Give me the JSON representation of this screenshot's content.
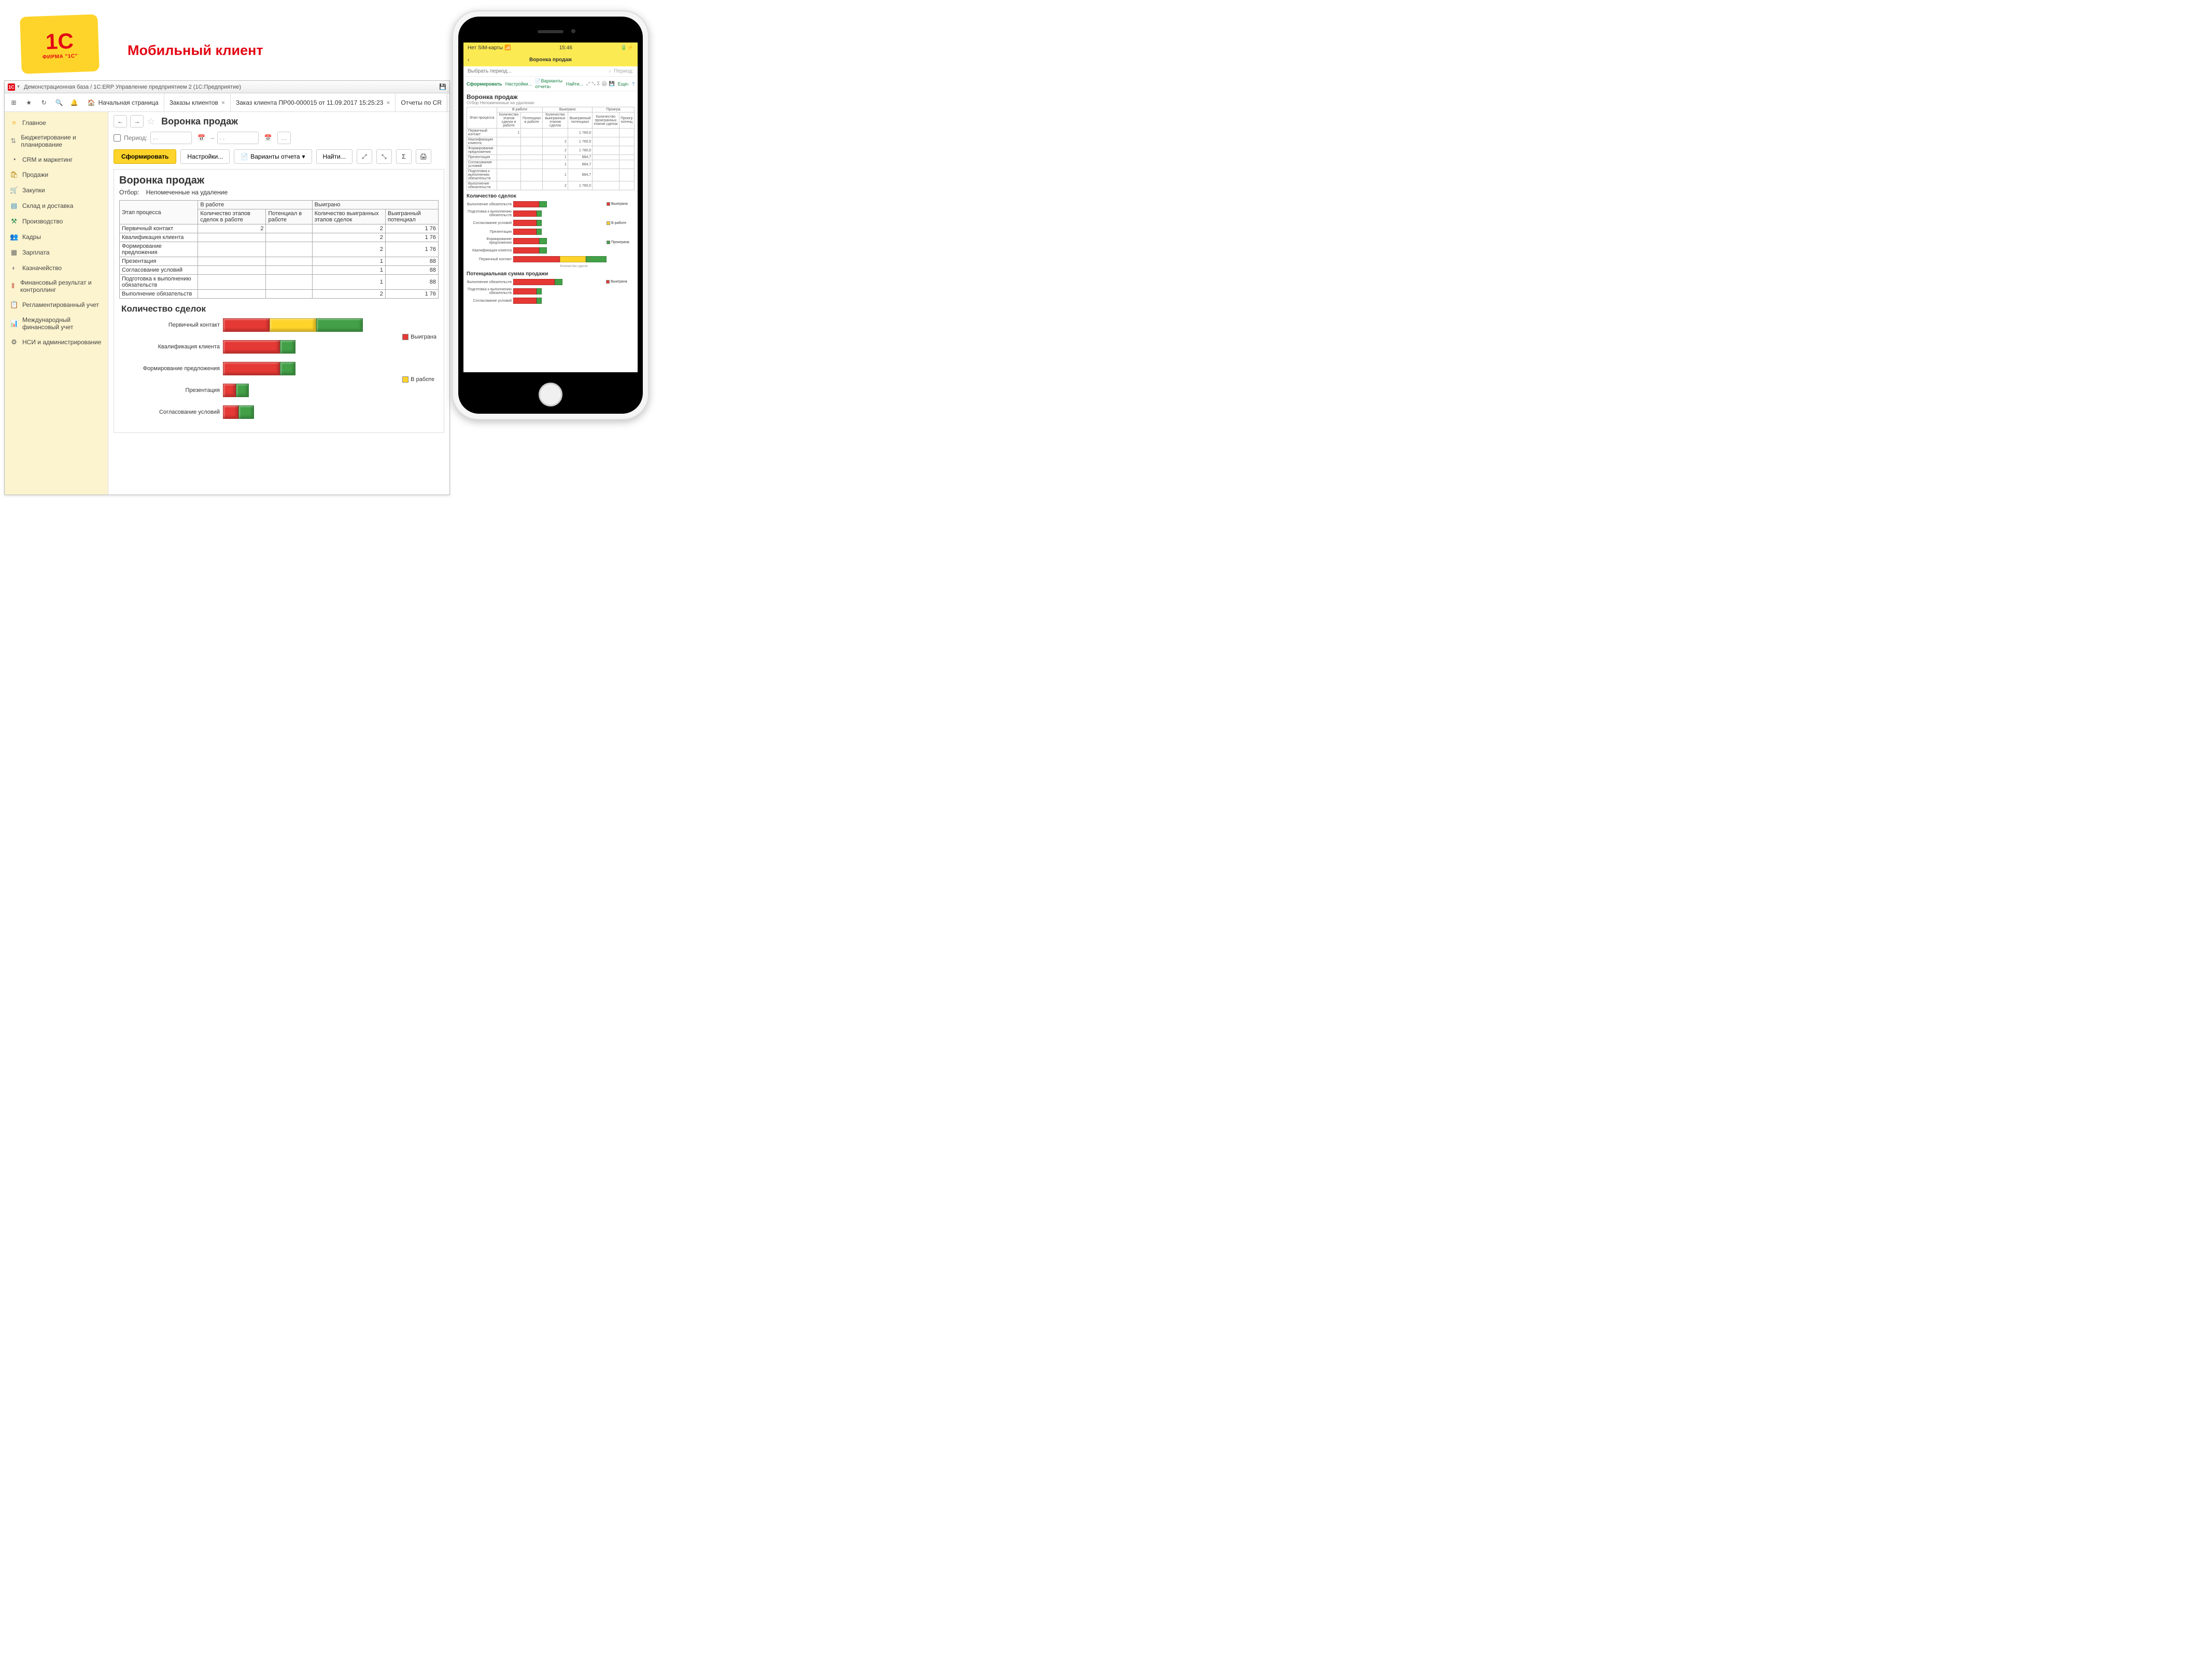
{
  "slide_title": "Мобильный клиент",
  "logo_text": "1C",
  "logo_sub": "ФИРМА \"1С\"",
  "window_title": "Демонстрационная база / 1С:ERP Управление предприятием 2  (1С:Предприятие)",
  "tabs": [
    {
      "label": "Начальная страница",
      "home": true
    },
    {
      "label": "Заказы клиентов",
      "closable": true
    },
    {
      "label": "Заказ клиента ПР00-000015 от 11.09.2017 15:25:23",
      "closable": true
    },
    {
      "label": "Отчеты по CR"
    }
  ],
  "sidebar": [
    {
      "icon": "≡",
      "cls": "sic-hamb",
      "label": "Главное"
    },
    {
      "icon": "⇅",
      "cls": "sic-bud",
      "label": "Бюджетирование и планирование"
    },
    {
      "icon": "◔",
      "cls": "sic-crm",
      "label": "CRM и маркетинг"
    },
    {
      "icon": "🛍",
      "cls": "sic-prod",
      "label": "Продажи"
    },
    {
      "icon": "🛒",
      "cls": "sic-cart",
      "label": "Закупки"
    },
    {
      "icon": "▤",
      "cls": "sic-store",
      "label": "Склад и доставка"
    },
    {
      "icon": "⚒",
      "cls": "sic-mfg",
      "label": "Производство"
    },
    {
      "icon": "👥",
      "cls": "sic-hr",
      "label": "Кадры"
    },
    {
      "icon": "▦",
      "cls": "sic-pay",
      "label": "Зарплата"
    },
    {
      "icon": "◐",
      "cls": "sic-treas",
      "label": "Казначейство"
    },
    {
      "icon": "⫴",
      "cls": "sic-fin",
      "label": "Финансовый результат и контроллинг"
    },
    {
      "icon": "📋",
      "cls": "sic-reg",
      "label": "Регламентированный учет"
    },
    {
      "icon": "📊",
      "cls": "sic-ifrs",
      "label": "Международный финансовый учет"
    },
    {
      "icon": "⚙",
      "cls": "sic-admin",
      "label": "НСИ и администрирование"
    }
  ],
  "page_title": "Воронка продаж",
  "period": {
    "label": "Период:",
    "from_placeholder": ". .",
    "to_placeholder": ". ."
  },
  "actions": {
    "form": "Сформировать",
    "settings": "Настройки...",
    "variants": "Варианты отчета",
    "find": "Найти..."
  },
  "report": {
    "title": "Воронка продаж",
    "filter_label": "Отбор:",
    "filter_value": "Непомеченные на удаление",
    "headers_top": [
      "Этап процесса",
      "В работе",
      "Выиграно"
    ],
    "headers_sub": [
      "Количество этапов сделок в работе",
      "Потенциал в работе",
      "Количество выигранных этапов сделок",
      "Выигранный потенциал"
    ],
    "rows": [
      {
        "stage": "Первичный контакт",
        "in_work": 2,
        "won": 2,
        "won_pot": "1 76"
      },
      {
        "stage": "Квалификация клиента",
        "in_work": "",
        "won": 2,
        "won_pot": "1 76"
      },
      {
        "stage": "Формирование предложения",
        "in_work": "",
        "won": 2,
        "won_pot": "1 76"
      },
      {
        "stage": "Презентация",
        "in_work": "",
        "won": 1,
        "won_pot": "88"
      },
      {
        "stage": "Согласование условий",
        "in_work": "",
        "won": 1,
        "won_pot": "88"
      },
      {
        "stage": "Подготовка к выполнению обязательств",
        "in_work": "",
        "won": 1,
        "won_pot": "88"
      },
      {
        "stage": "Выполнение обязательств",
        "in_work": "",
        "won": 2,
        "won_pot": "1 76"
      }
    ]
  },
  "chart_title": "Количество сделок",
  "chart_data": {
    "type": "bar",
    "orientation": "horizontal",
    "title": "Количество сделок",
    "stacked": true,
    "categories": [
      "Первичный контакт",
      "Квалификация клиента",
      "Формирование предложения",
      "Презентация",
      "Согласование условий"
    ],
    "series": [
      {
        "name": "Выиграна",
        "color": "#e53935",
        "values": [
          90,
          110,
          110,
          25,
          30
        ]
      },
      {
        "name": "В работе",
        "color": "#ffd42a",
        "values": [
          90,
          0,
          0,
          0,
          0
        ]
      },
      {
        "name": "Проиграна",
        "color": "#43a047",
        "values": [
          90,
          30,
          30,
          25,
          30
        ]
      }
    ],
    "legend": [
      "Выиграна",
      "В работе"
    ]
  },
  "mobile": {
    "status_left": "Нет SIM-карты",
    "status_time": "15:46",
    "title": "Воронка продаж",
    "period_placeholder": "Выбрать период...",
    "period_label": "Период:",
    "act_form": "Сформировать",
    "act_settings": "Настройки...",
    "act_variants": "Варианты отчета",
    "act_find": "Найти...",
    "act_more": "Еще",
    "report_title": "Воронка продаж",
    "filter": "Отбор   Непомеченные на удаление",
    "headers": [
      "Этап процесса",
      "В работе",
      "",
      "Выиграно",
      "",
      "Проигра"
    ],
    "sub_headers": [
      "",
      "Количество этапов сделок в работе",
      "Потенциал в работе",
      "Количество выигранных этапов сделок",
      "Выигранный потенциал",
      "Количество проигранных этапов сделок",
      "Проигр потенц"
    ],
    "rows": [
      {
        "stage": "Первичный контакт",
        "c1": "1",
        "c3": "",
        "c4": "1 760,0"
      },
      {
        "stage": "Квалификация клиента",
        "c1": "",
        "c3": "2",
        "c4": "1 760,0"
      },
      {
        "stage": "Формирование предложения",
        "c1": "",
        "c3": "2",
        "c4": "1 760,0"
      },
      {
        "stage": "Презентация",
        "c1": "",
        "c3": "1",
        "c4": "884,7"
      },
      {
        "stage": "Согласование условий",
        "c1": "",
        "c3": "1",
        "c4": "884,7"
      },
      {
        "stage": "Подготовка к выполнению обязательств",
        "c1": "",
        "c3": "1",
        "c4": "884,7"
      },
      {
        "stage": "Выполнение обязательств",
        "c1": "",
        "c3": "2",
        "c4": "1 760,0"
      }
    ],
    "chart1_title": "Количество сделок",
    "chart1_xlabel": "Количество сделок",
    "chart1": {
      "type": "bar",
      "orientation": "horizontal",
      "stacked": true,
      "categories": [
        "Выполнение обязательств",
        "Подготовка к выполнению обязательств",
        "Согласование условий",
        "Презентация",
        "Формирование предложения",
        "Квалификация клиента",
        "Первичный контакт"
      ],
      "series": [
        {
          "name": "Выиграна",
          "color": "#e53935",
          "values": [
            50,
            45,
            45,
            45,
            50,
            50,
            90
          ]
        },
        {
          "name": "В работе",
          "color": "#ffd42a",
          "values": [
            0,
            0,
            0,
            0,
            0,
            0,
            50
          ]
        },
        {
          "name": "Проиграна",
          "color": "#43a047",
          "values": [
            15,
            10,
            10,
            10,
            15,
            15,
            40
          ]
        }
      ],
      "legend": [
        "Выиграна",
        "В работе",
        "Проиграна"
      ]
    },
    "chart2_title": "Потенциальная сумма продажи",
    "chart2": {
      "type": "bar",
      "orientation": "horizontal",
      "stacked": true,
      "categories": [
        "Выполнение обязательств",
        "Подготовка к выполнению обязательств",
        "Согласование условий"
      ],
      "series": [
        {
          "name": "Выиграна",
          "color": "#e53935",
          "values": [
            80,
            45,
            45
          ]
        },
        {
          "name": "Проиграна",
          "color": "#43a047",
          "values": [
            15,
            10,
            10
          ]
        }
      ],
      "legend": [
        "Выиграна"
      ]
    }
  }
}
